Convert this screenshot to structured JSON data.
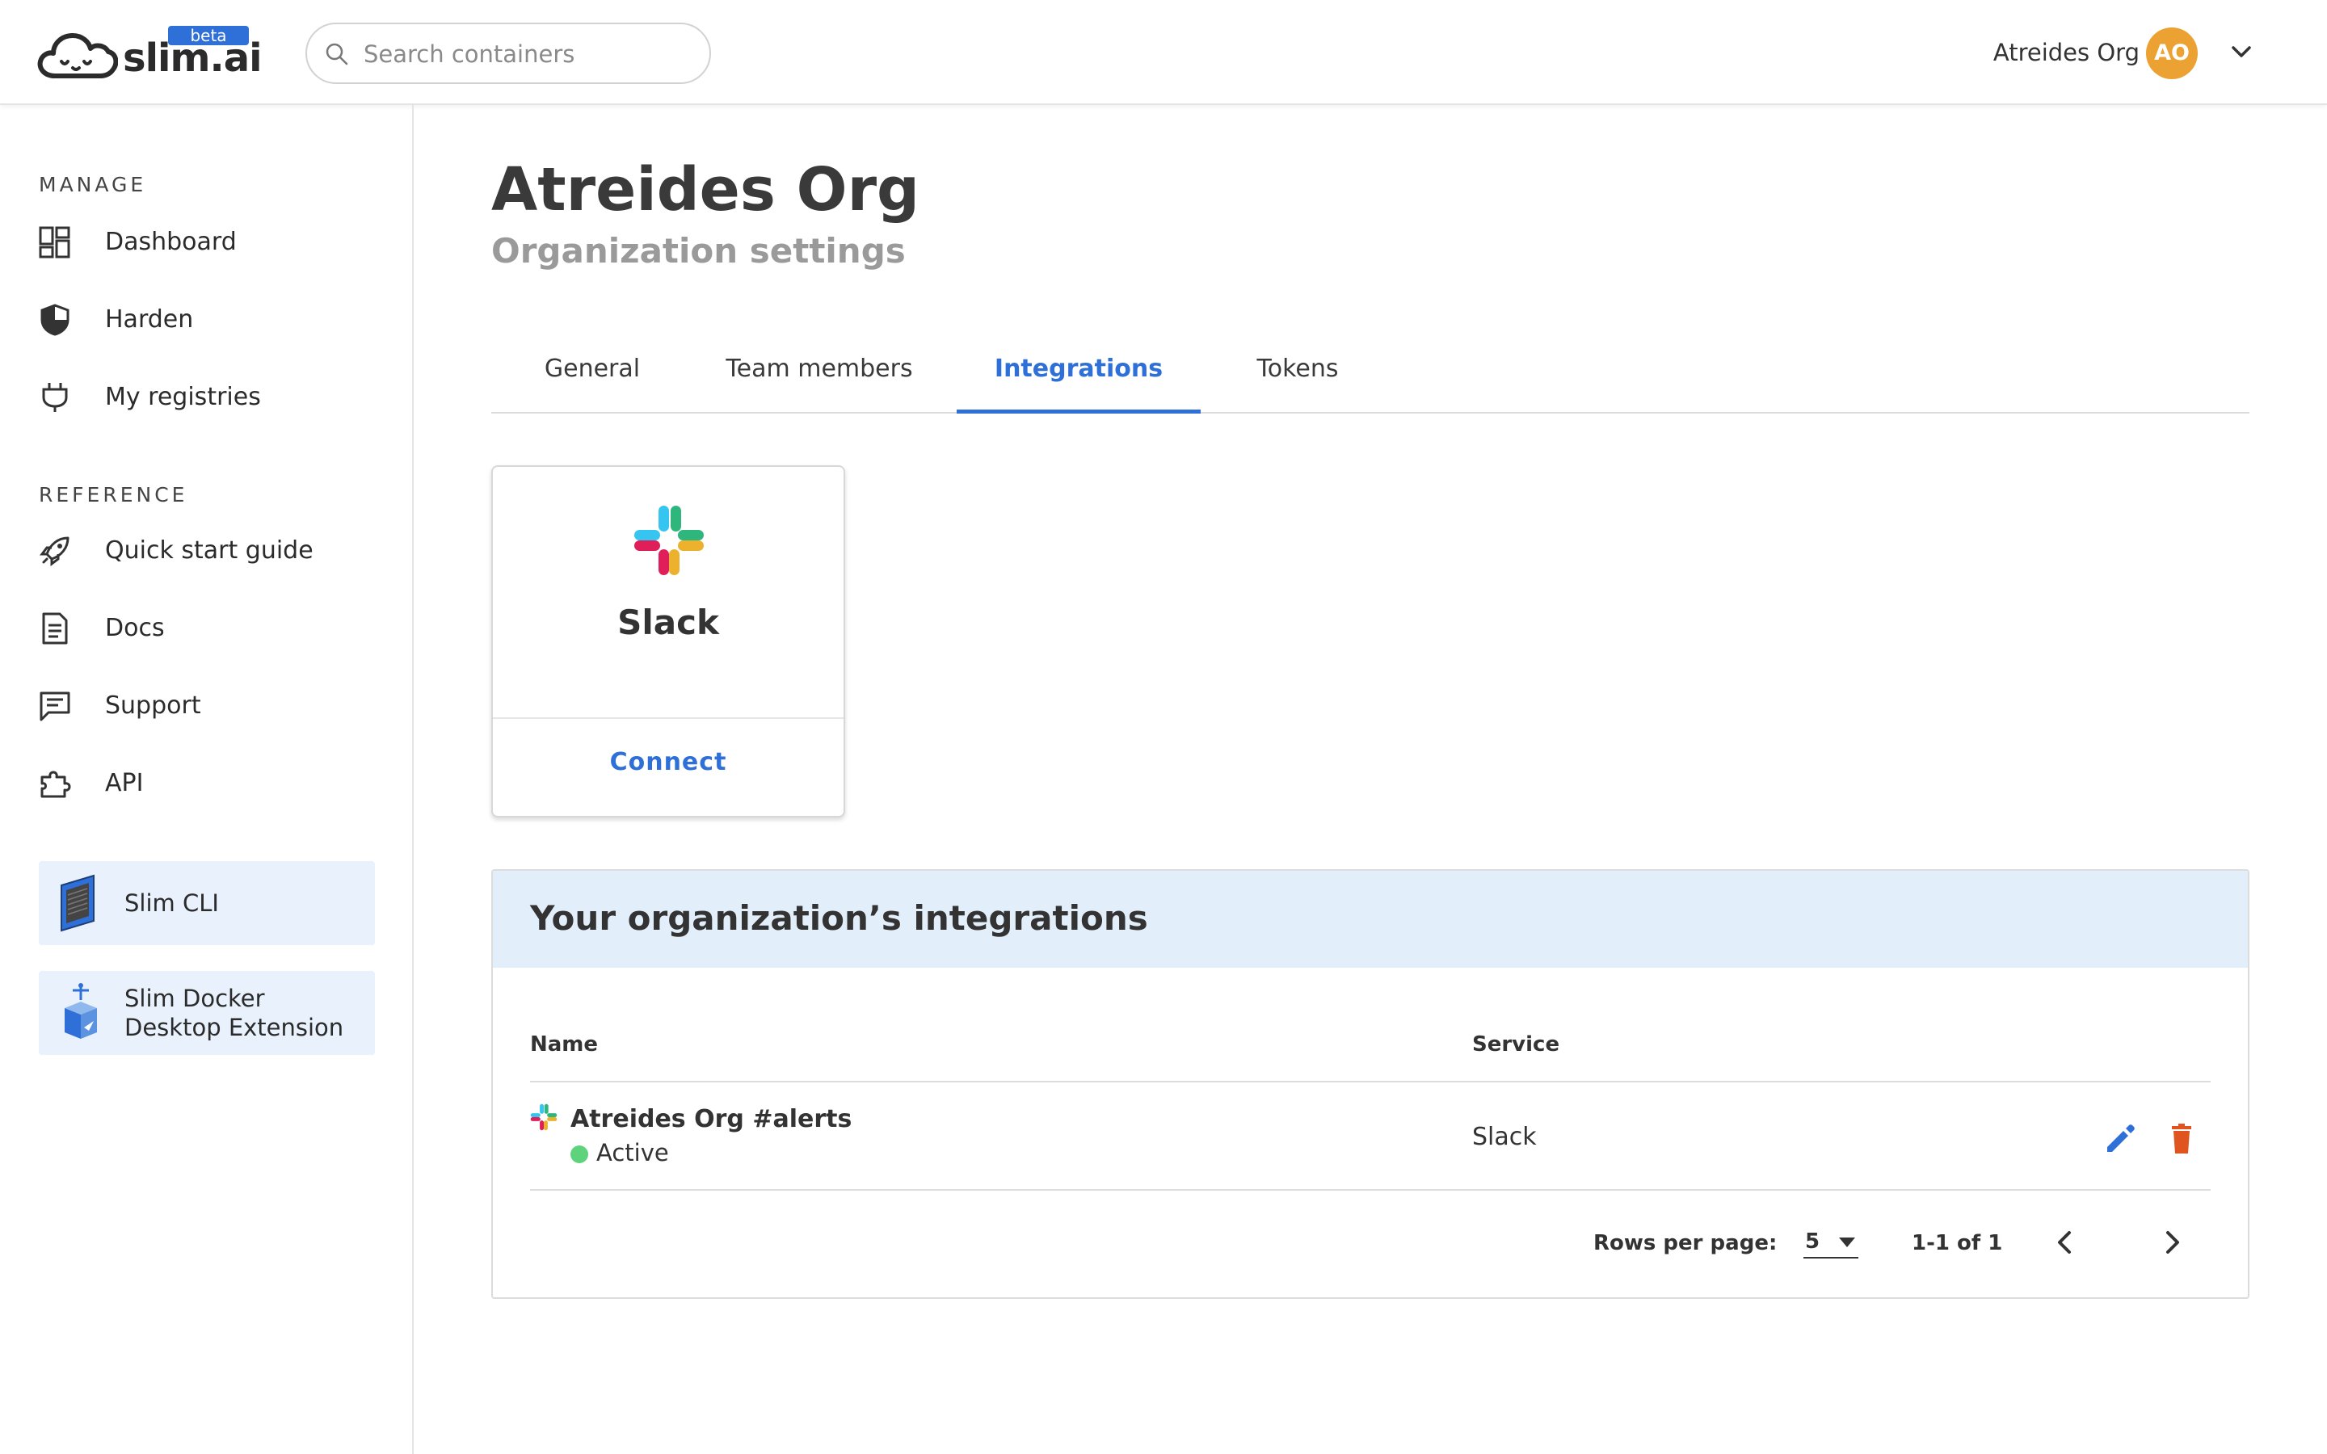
{
  "header": {
    "logo_text": "slim.ai",
    "beta_badge": "beta",
    "search_placeholder": "Search containers",
    "org_name": "Atreides Org",
    "avatar_initials": "AO"
  },
  "sidebar": {
    "manage_label": "MANAGE",
    "manage_items": [
      {
        "label": "Dashboard",
        "icon": "dashboard-icon"
      },
      {
        "label": "Harden",
        "icon": "shield-icon"
      },
      {
        "label": "My registries",
        "icon": "plug-icon"
      }
    ],
    "reference_label": "REFERENCE",
    "reference_items": [
      {
        "label": "Quick start guide",
        "icon": "rocket-icon"
      },
      {
        "label": "Docs",
        "icon": "document-icon"
      },
      {
        "label": "Support",
        "icon": "chat-icon"
      },
      {
        "label": "API",
        "icon": "puzzle-icon"
      }
    ],
    "promos": [
      {
        "label": "Slim CLI",
        "icon": "terminal-icon"
      },
      {
        "label_line1": "Slim Docker",
        "label_line2": "Desktop Extension",
        "icon": "docker-extension-icon"
      }
    ]
  },
  "main": {
    "title": "Atreides Org",
    "subtitle": "Organization settings",
    "tabs": [
      {
        "label": "General",
        "active": false
      },
      {
        "label": "Team members",
        "active": false
      },
      {
        "label": "Integrations",
        "active": true
      },
      {
        "label": "Tokens",
        "active": false
      }
    ],
    "integration_card": {
      "name": "Slack",
      "action": "Connect"
    },
    "integrations_panel": {
      "title": "Your organization’s integrations",
      "columns": [
        "Name",
        "Service"
      ],
      "rows": [
        {
          "name": "Atreides Org #alerts",
          "status": "Active",
          "service": "Slack"
        }
      ],
      "pagination": {
        "rows_per_page_label": "Rows per page:",
        "rows_per_page": "5",
        "range": "1-1 of 1"
      }
    }
  },
  "colors": {
    "accent": "#2f6fd8",
    "avatar": "#eba233",
    "active_status": "#5dd37c",
    "delete": "#e0541f",
    "panel_header": "#e3eefb"
  }
}
